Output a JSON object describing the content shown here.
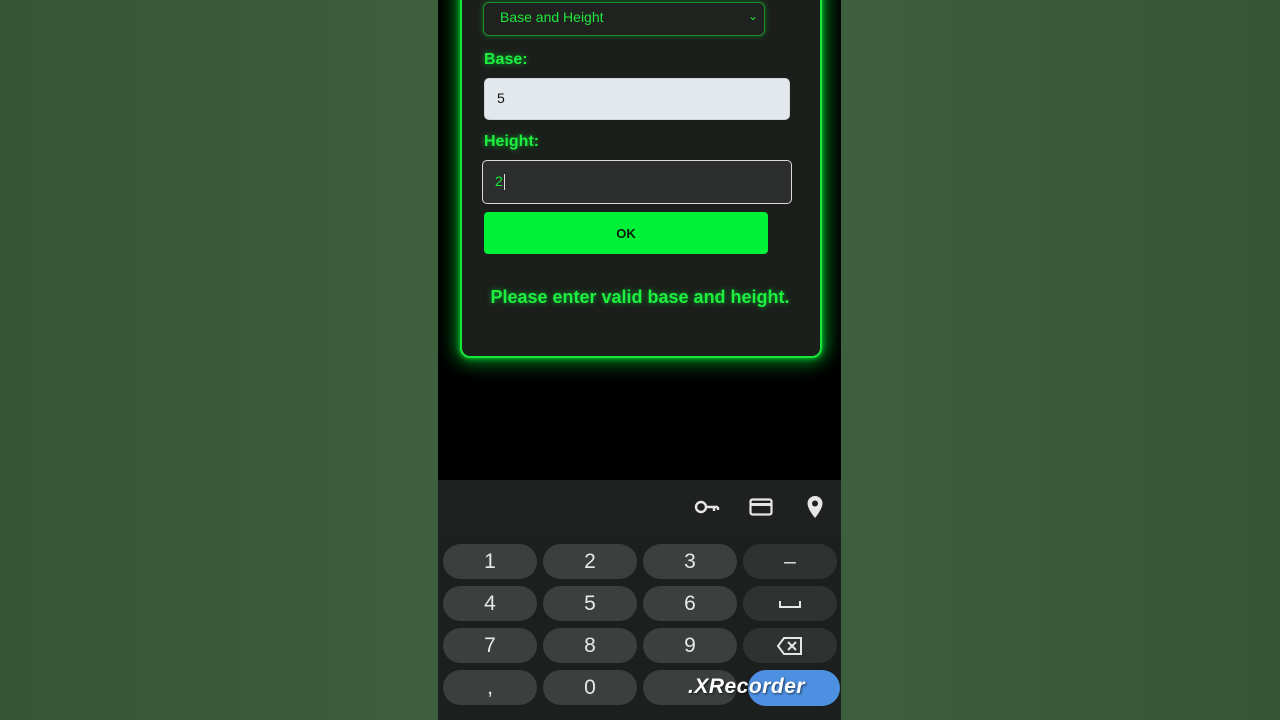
{
  "app": {
    "select": {
      "value": "Base and Height"
    },
    "base_label": "Base:",
    "base_value": "5",
    "height_label": "Height:",
    "height_value": "2",
    "ok_label": "OK",
    "message": "Please enter valid base and height."
  },
  "autofill_icons": [
    "key-icon",
    "credit-card-icon",
    "location-pin-icon"
  ],
  "keyboard": {
    "rows": [
      [
        "1",
        "2",
        "3",
        "–"
      ],
      [
        "4",
        "5",
        "6",
        "space"
      ],
      [
        "7",
        "8",
        "9",
        "backspace"
      ],
      [
        ",",
        "0",
        ".",
        "enter"
      ]
    ]
  },
  "watermark": ".XRecorder",
  "colors": {
    "neon": "#1ef03f",
    "button": "#00f238",
    "background": "#000000"
  }
}
